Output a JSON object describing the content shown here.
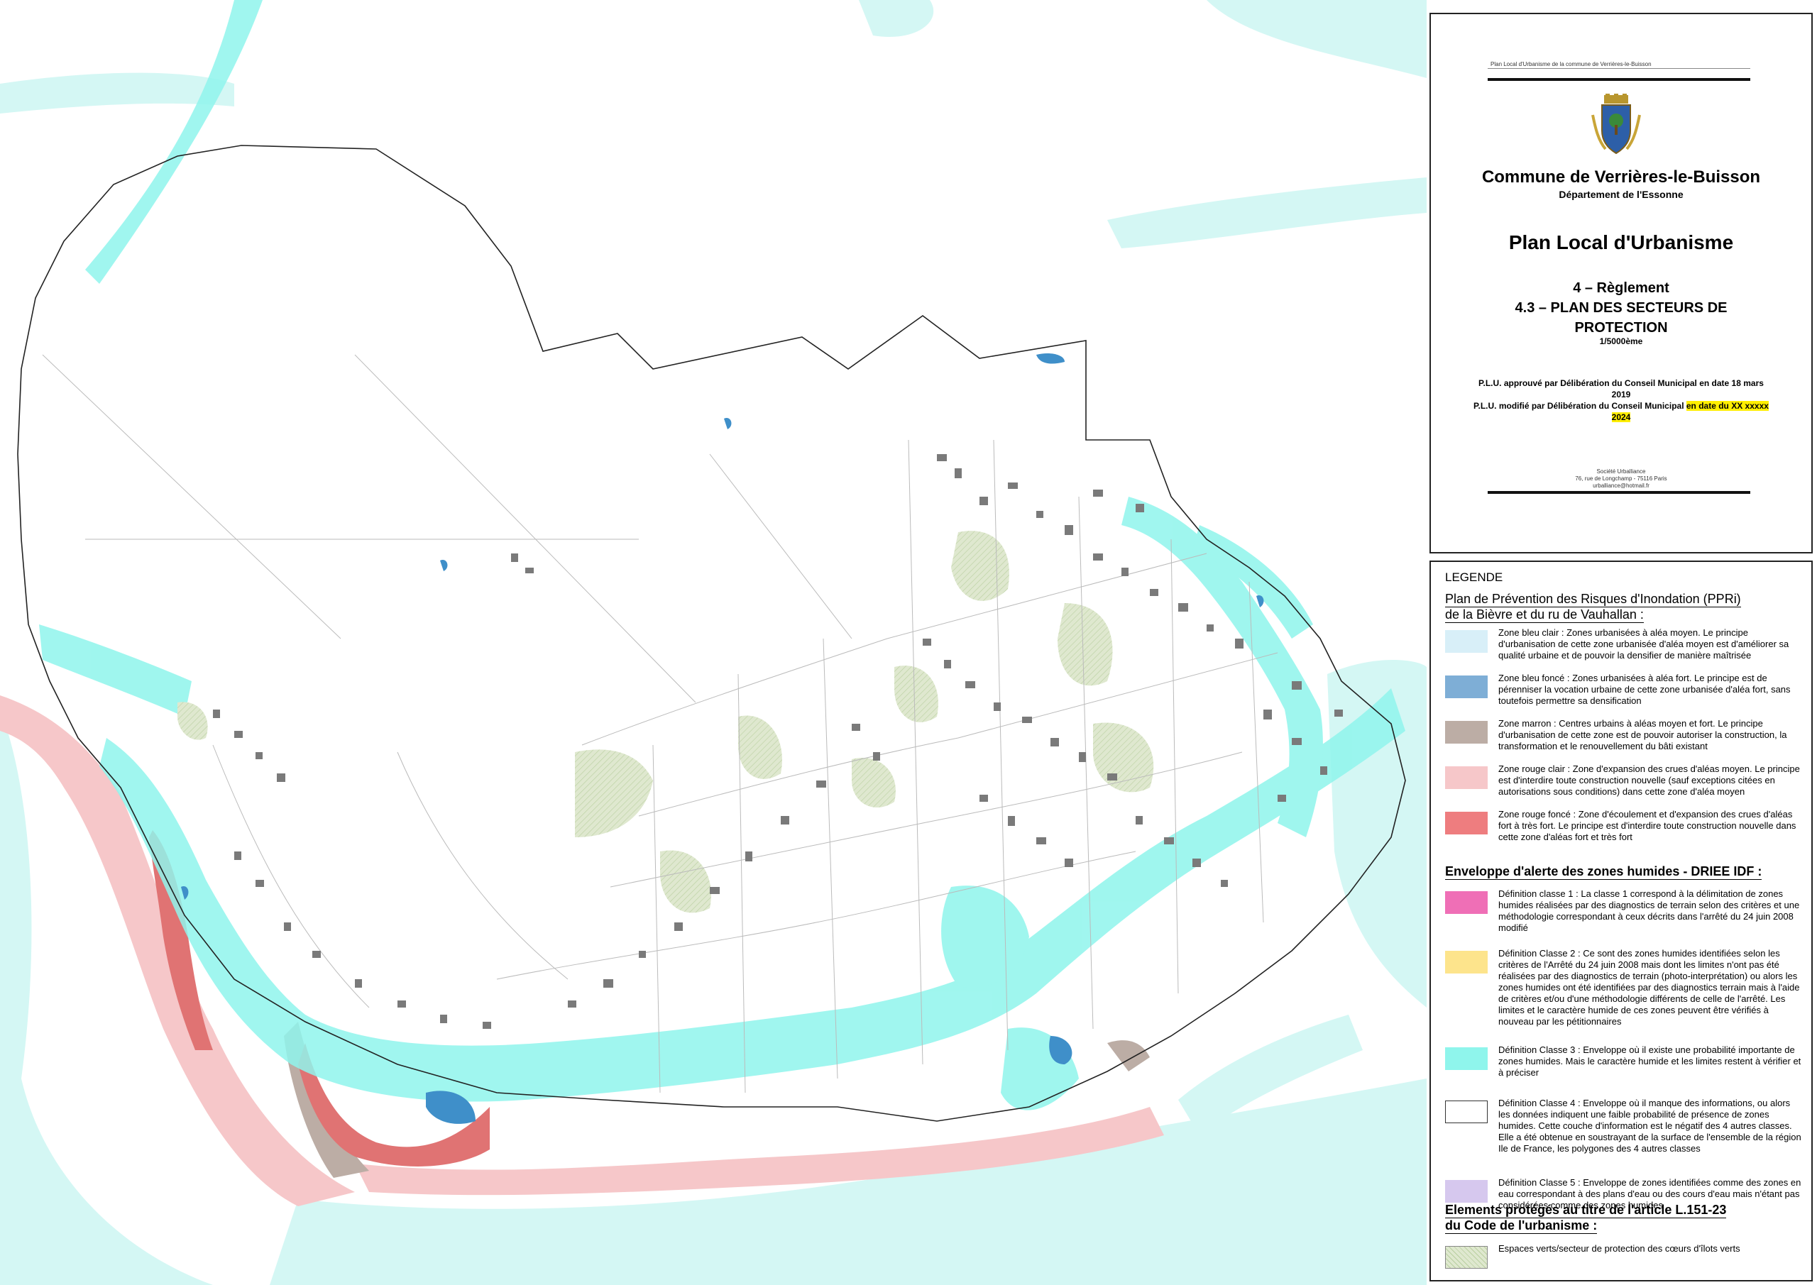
{
  "cartouche": {
    "header_small": "Plan Local d'Urbanisme de la commune de Verrières-le-Buisson",
    "commune": "Commune de Verrières-le-Buisson",
    "departement": "Département de l'Essonne",
    "plu_title": "Plan Local d'Urbanisme",
    "section": "4 – Règlement",
    "subsection_line1": "4.3 – PLAN DES SECTEURS DE",
    "subsection_line2": "PROTECTION",
    "scale": "1/5000ème",
    "approval_1": "P.L.U. approuvé par Délibération du Conseil Municipal en date 18 mars 2019",
    "approval_2": "P.L.U. modifié par Délibération du Conseil Municipal",
    "approval_2_highlight": "en date du XX xxxxx 2024",
    "societe_name": "Société Urballiance",
    "societe_address": "76, rue de Longchamp - 75116 Paris",
    "societe_email": "urballiance@hotmail.fr"
  },
  "legend": {
    "title": "LEGENDE",
    "ppri": {
      "title_line1": "Plan de Prévention des Risques d'Inondation (PPRi)",
      "title_line2": "de la Bièvre et du ru de Vauhallan :",
      "items": [
        {
          "color": "#d8eff8",
          "text": "Zone bleu clair : Zones urbanisées à aléa moyen. Le principe d'urbanisation de cette zone urbanisée d'aléa moyen est d'améliorer sa qualité urbaine et de pouvoir la densifier de manière maîtrisée"
        },
        {
          "color": "#7eaed6",
          "text": "Zone bleu foncé : Zones urbanisées à aléa fort. Le principe est de pérenniser la vocation urbaine de cette zone urbanisée d'aléa fort, sans toutefois permettre sa densification"
        },
        {
          "color": "#bcada5",
          "text": "Zone marron : Centres urbains à aléas moyen et fort. Le principe d'urbanisation de cette zone est de pouvoir autoriser la construction, la transformation et le renouvellement du bâti existant"
        },
        {
          "color": "#f6c7c9",
          "text": "Zone rouge clair : Zone d'expansion des crues d'aléas moyen. Le principe est d'interdire toute construction nouvelle (sauf exceptions citées en autorisations sous conditions) dans cette zone d'aléa moyen"
        },
        {
          "color": "#ee7d7f",
          "text": "Zone rouge foncé : Zone d'écoulement et d'expansion des crues d'aléas fort à très fort. Le principe est d'interdire toute construction nouvelle dans cette zone d'aléas fort et très fort"
        }
      ]
    },
    "driee": {
      "title": "Enveloppe d'alerte des zones humides - DRIEE IDF :",
      "items": [
        {
          "color": "#ef6fb6",
          "text": "Définition classe 1 : La classe 1 correspond à la délimitation de zones humides réalisées par des diagnostics de terrain selon des critères et une méthodologie correspondant à ceux décrits dans l'arrêté du 24 juin 2008 modifié"
        },
        {
          "color": "#fde48c",
          "text": "Définition Classe 2 : Ce sont des zones humides identifiées selon les critères de l'Arrêté du 24 juin 2008 mais dont les limites n'ont pas été réalisées par des diagnostics de terrain (photo-interprétation) ou alors les zones humides ont été identifiées par des diagnostics terrain mais à l'aide de critères et/ou d'une méthodologie différents de celle de l'arrêté. Les limites et le caractère humide de ces zones peuvent être vérifiés à nouveau par les pétitionnaires"
        },
        {
          "color": "#8ff5ec",
          "text": "Définition Classe 3 : Enveloppe où il existe une probabilité importante de zones humides. Mais le caractère humide et les limites restent à vérifier et à préciser"
        },
        {
          "color": "#ffffff",
          "text": "Définition Classe 4 : Enveloppe où il manque des informations, ou alors les données indiquent une faible probabilité de présence de zones humides. Cette couche d'information est le négatif des 4 autres classes. Elle a été obtenue en soustrayant de la surface de l'ensemble de la région Ile de France, les polygones des 4 autres classes"
        },
        {
          "color": "#d6c8ee",
          "text": "Définition Classe 5 : Enveloppe de zones identifiées comme des zones en eau correspondant à des plans d'eau ou des cours d'eau mais n'étant pas considérées comme des zones humides"
        }
      ]
    },
    "elements": {
      "title_line1": "Elements protégés au titre de l'article L.151-23",
      "title_line2": "du Code de l'urbanisme :",
      "items": [
        {
          "color": "#dfe8cf",
          "text": "Espaces verts/secteur de protection des cœurs d'îlots verts"
        }
      ]
    }
  },
  "colors": {
    "humid_class3": "#8ff5ec",
    "humid_class3_light": "#d4f7f4",
    "ppri_red_dark": "#e07373",
    "ppri_red_light": "#f6c7c9",
    "ppri_brown": "#bcada5",
    "ppri_blue_dark": "#3f8fc9",
    "green_spaces": "#dfe8cf",
    "buildings": "#7a7a7a"
  }
}
